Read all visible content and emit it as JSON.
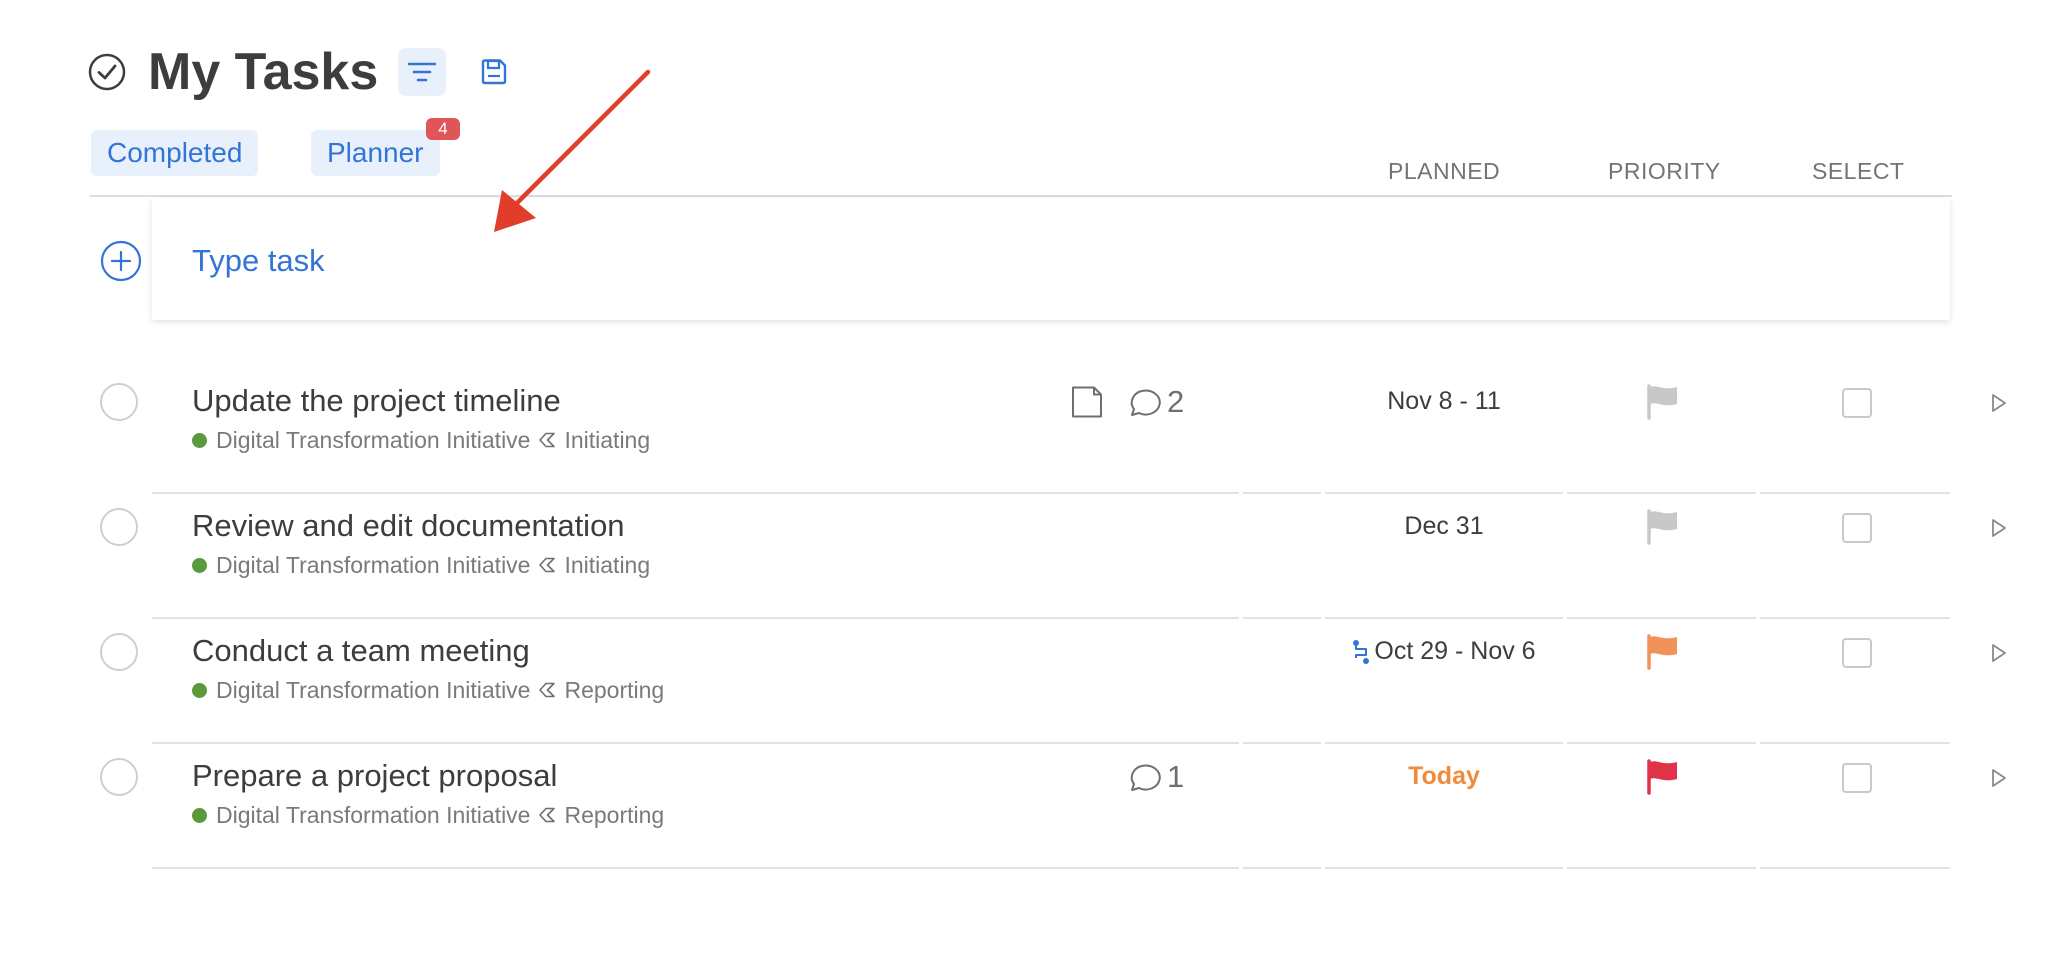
{
  "header": {
    "title": "My Tasks",
    "filter_icon": "filter-icon",
    "save_icon": "save-icon"
  },
  "tabs": {
    "completed": "Completed",
    "planner": "Planner",
    "planner_badge": "4"
  },
  "columns": {
    "planned": "PLANNED",
    "priority": "PRIORITY",
    "select": "SELECT"
  },
  "new_task": {
    "placeholder": "Type task"
  },
  "colors": {
    "accent": "#3375d6",
    "project_dot": "#5a9a3c",
    "badge": "#e0555a",
    "flag_none": "#c8c8c8",
    "flag_medium": "#f0925a",
    "flag_high": "#e0334a",
    "today": "#ef8b3a",
    "annotation": "#e23d2a"
  },
  "tasks": [
    {
      "title": "Update the project timeline",
      "project": "Digital Transformation Initiative",
      "phase": "Initiating",
      "has_note": true,
      "comments": "2",
      "planned": "Nov 8 - 11",
      "priority": "none"
    },
    {
      "title": "Review and edit documentation",
      "project": "Digital Transformation Initiative",
      "phase": "Initiating",
      "has_note": false,
      "comments": "",
      "planned": "Dec 31",
      "priority": "none"
    },
    {
      "title": "Conduct a team meeting",
      "project": "Digital Transformation Initiative",
      "phase": "Reporting",
      "has_note": false,
      "comments": "",
      "planned": "Oct 29 - Nov 6",
      "recurring": true,
      "priority": "medium"
    },
    {
      "title": "Prepare a project proposal",
      "project": "Digital Transformation Initiative",
      "phase": "Reporting",
      "has_note": false,
      "comments": "1",
      "planned": "Today",
      "priority": "high"
    }
  ]
}
